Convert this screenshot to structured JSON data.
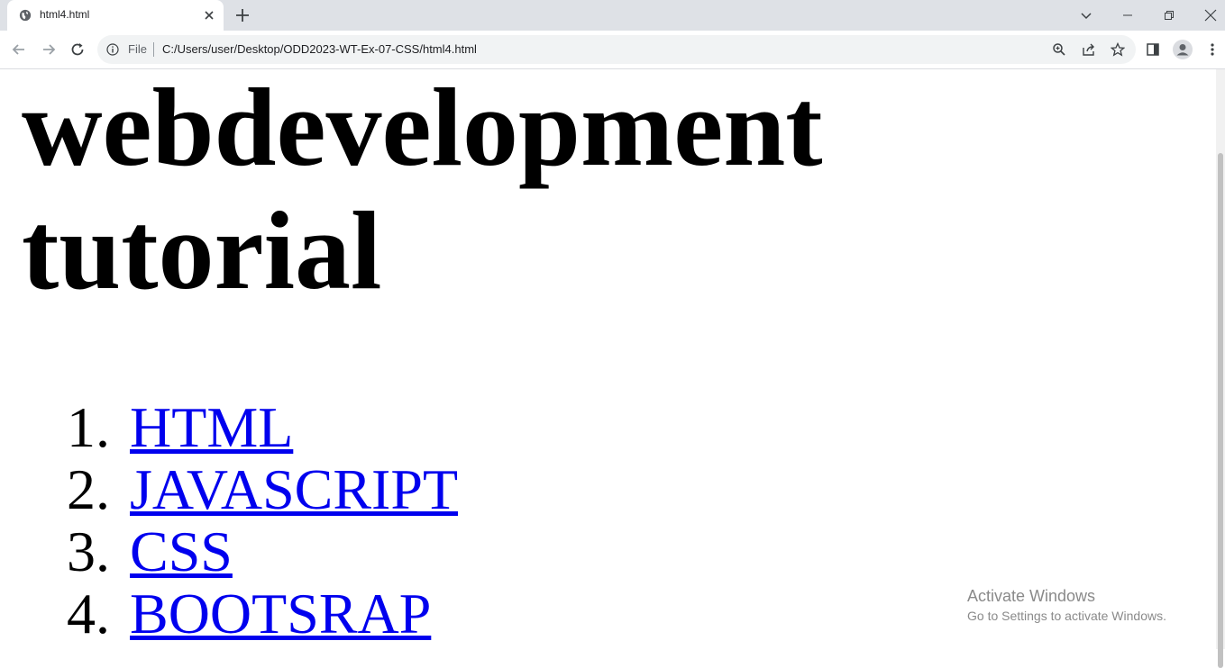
{
  "browser": {
    "tab": {
      "title": "html4.html"
    },
    "address_bar": {
      "scheme_label": "File",
      "url": "C:/Users/user/Desktop/ODD2023-WT-Ex-07-CSS/html4.html"
    }
  },
  "page": {
    "heading": "webdevelopment tutorial",
    "list": [
      {
        "number": "1.",
        "label": "HTML"
      },
      {
        "number": "2.",
        "label": "JAVASCRIPT"
      },
      {
        "number": "3.",
        "label": "CSS"
      },
      {
        "number": "4.",
        "label": "BOOTSRAP"
      }
    ],
    "link_color": "#0000ee"
  },
  "os_watermark": {
    "title": "Activate Windows",
    "subtitle": "Go to Settings to activate Windows."
  },
  "colors": {
    "tabstrip": "#dee1e6",
    "omnibox": "#f1f3f4"
  }
}
